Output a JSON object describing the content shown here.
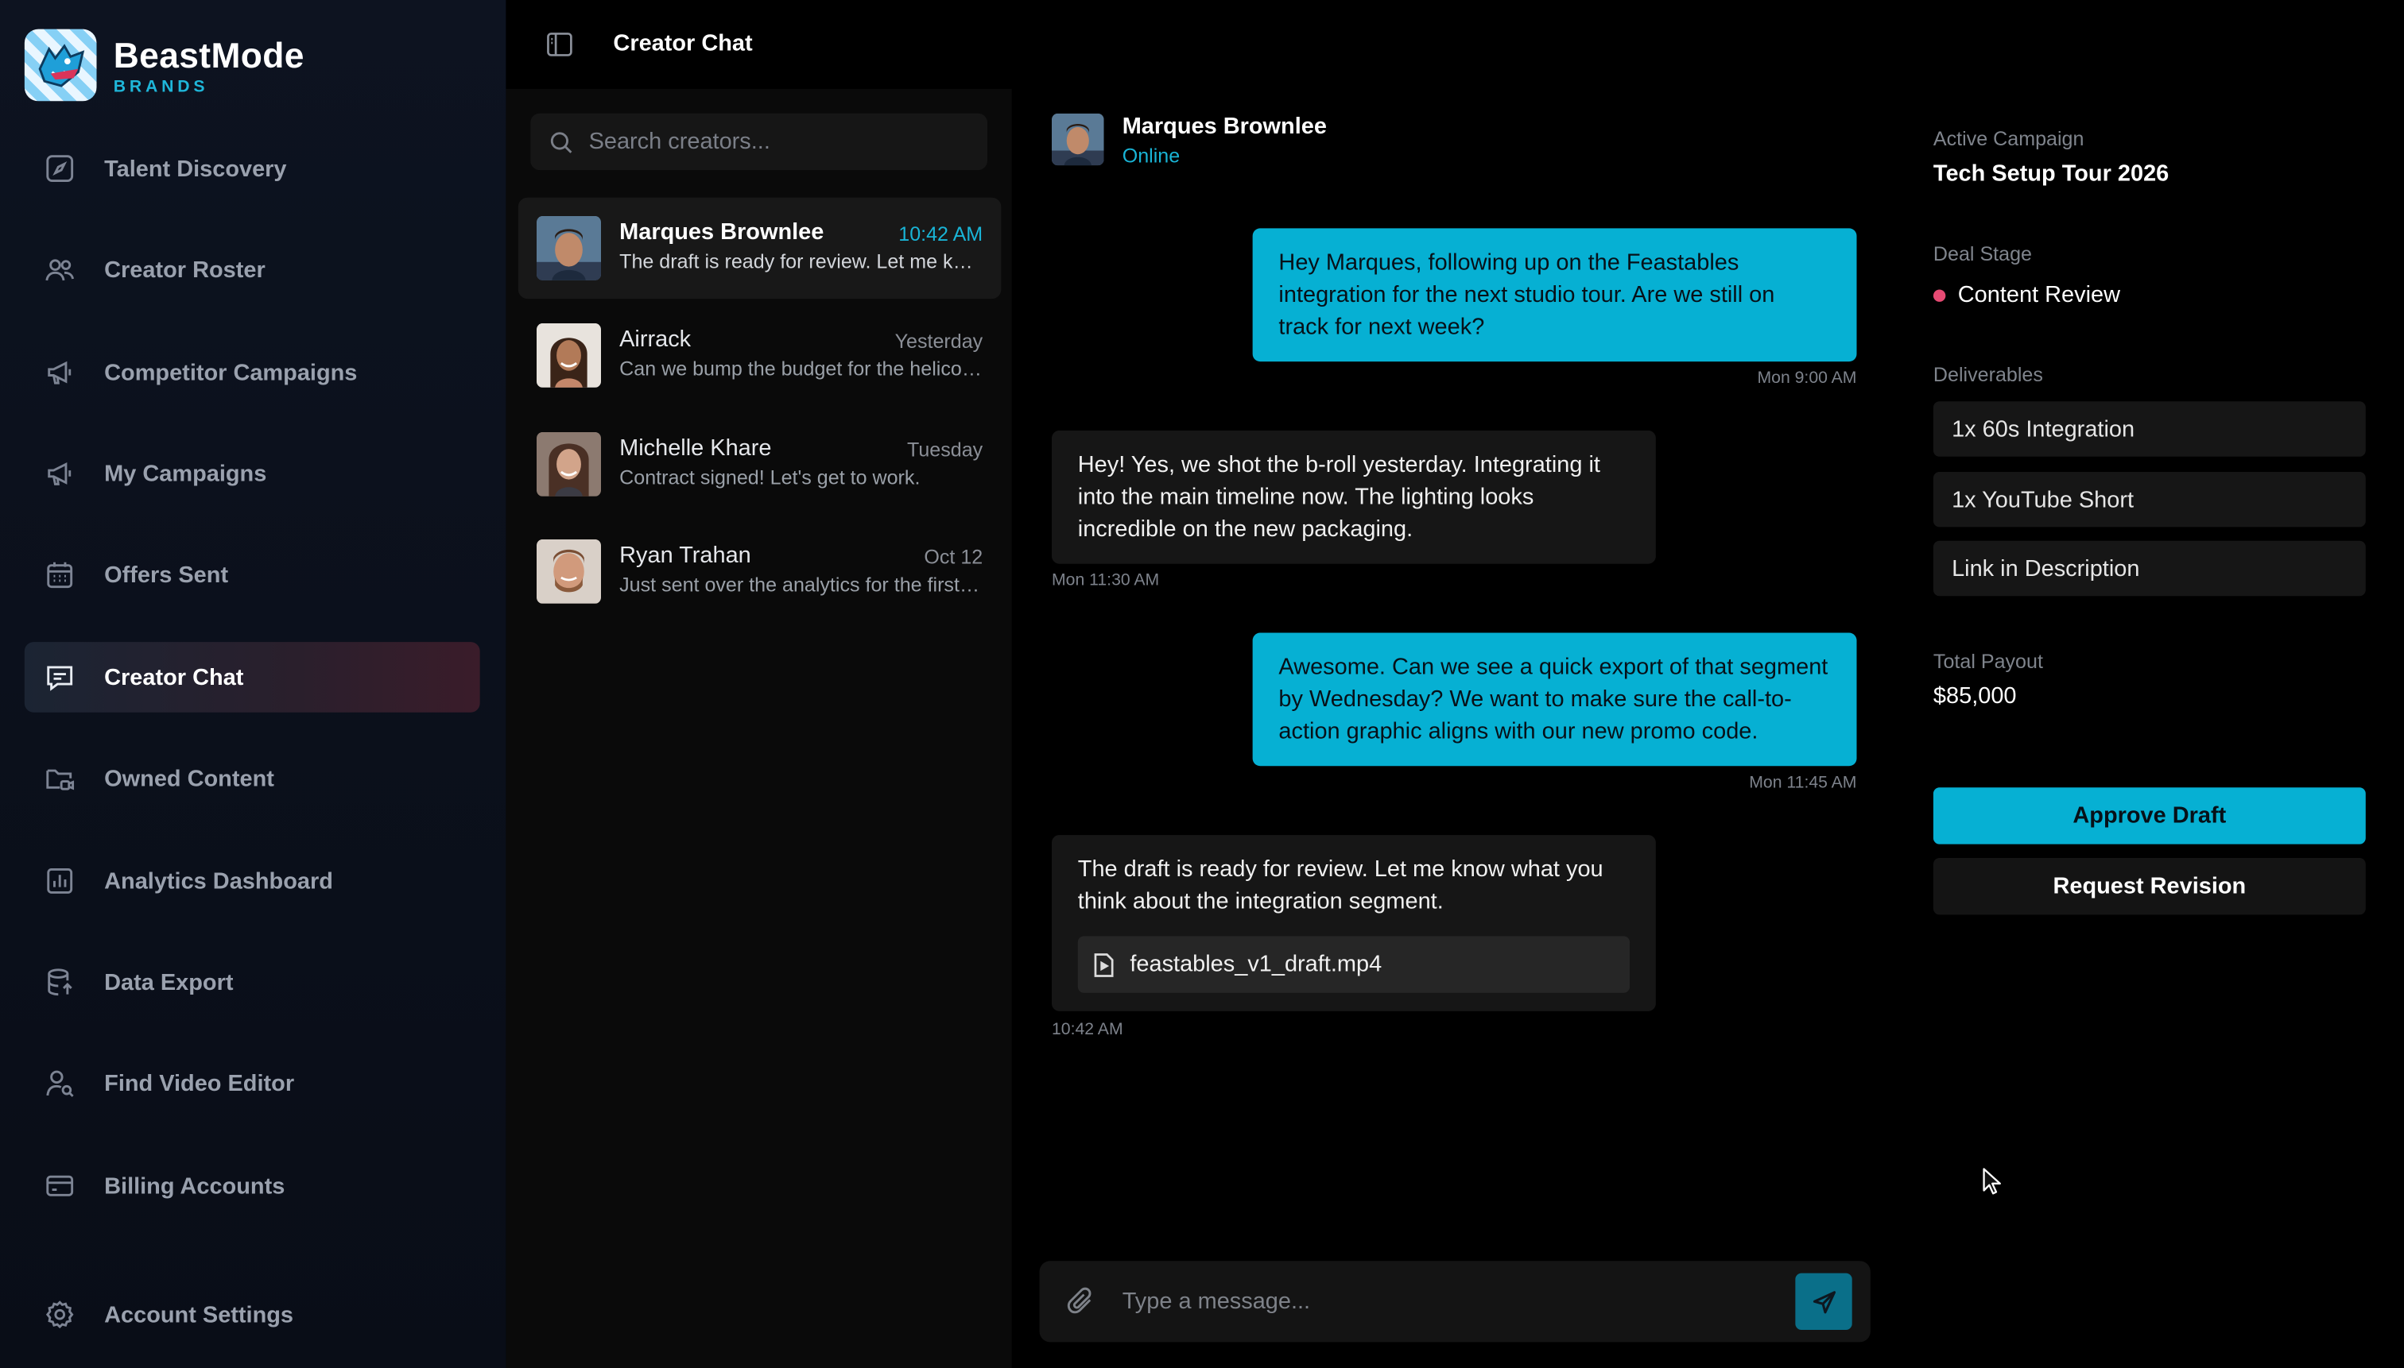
{
  "brand": {
    "title": "BeastMode",
    "subtitle": "BRANDS"
  },
  "sidebar": {
    "items": [
      {
        "label": "Talent Discovery",
        "icon": "compass-icon"
      },
      {
        "label": "Creator Roster",
        "icon": "users-icon"
      },
      {
        "label": "Competitor Campaigns",
        "icon": "megaphone-icon"
      },
      {
        "label": "My Campaigns",
        "icon": "megaphone-icon"
      },
      {
        "label": "Offers Sent",
        "icon": "calendar-icon"
      },
      {
        "label": "Creator Chat",
        "icon": "chat-icon",
        "active": true
      },
      {
        "label": "Owned Content",
        "icon": "folder-video-icon"
      },
      {
        "label": "Analytics Dashboard",
        "icon": "bar-chart-icon"
      },
      {
        "label": "Data Export",
        "icon": "database-export-icon"
      },
      {
        "label": "Find Video Editor",
        "icon": "user-search-icon"
      },
      {
        "label": "Billing Accounts",
        "icon": "credit-card-icon"
      }
    ],
    "settings_label": "Account Settings"
  },
  "header": {
    "title": "Creator Chat"
  },
  "search": {
    "placeholder": "Search creators..."
  },
  "conversations": [
    {
      "name": "Marques Brownlee",
      "time": "10:42 AM",
      "preview": "The draft is ready for review. Let me know what you think about the integration segment.",
      "active": true
    },
    {
      "name": "Airrack",
      "time": "Yesterday",
      "preview": "Can we bump the budget for the helicopter shot?"
    },
    {
      "name": "Michelle Khare",
      "time": "Tuesday",
      "preview": "Contract signed! Let's get to work."
    },
    {
      "name": "Ryan Trahan",
      "time": "Oct 12",
      "preview": "Just sent over the analytics for the first week."
    }
  ],
  "chat": {
    "contact_name": "Marques Brownlee",
    "status": "Online",
    "messages": [
      {
        "text": "Hey Marques, following up on the Feastables integration for the next studio tour. Are we still on track for next week?",
        "time": "Mon 9:00 AM"
      },
      {
        "text": "Hey! Yes, we shot the b-roll yesterday. Integrating it into the main timeline now. The lighting looks incredible on the new packaging.",
        "time": "Mon 11:30 AM"
      },
      {
        "text": "Awesome. Can we see a quick export of that segment by Wednesday? We want to make sure the call-to-action graphic aligns with our new promo code.",
        "time": "Mon 11:45 AM"
      },
      {
        "text": "The draft is ready for review. Let me know what you think about the integration segment.",
        "time": "10:42 AM",
        "attachment": "feastables_v1_draft.mp4"
      }
    ],
    "composer_placeholder": "Type a message..."
  },
  "details": {
    "campaign_label": "Active Campaign",
    "campaign_value": "Tech Setup Tour 2026",
    "stage_label": "Deal Stage",
    "stage_value": "Content Review",
    "stage_color": "#e64a73",
    "deliverables_label": "Deliverables",
    "deliverables": [
      "1x 60s Integration",
      "1x YouTube Short",
      "Link in Description"
    ],
    "payout_label": "Total Payout",
    "payout_value": "$85,000",
    "approve_label": "Approve Draft",
    "revision_label": "Request Revision"
  },
  "colors": {
    "accent": "#06b0d3",
    "status_dot": "#e64a73",
    "background": "#000000"
  }
}
